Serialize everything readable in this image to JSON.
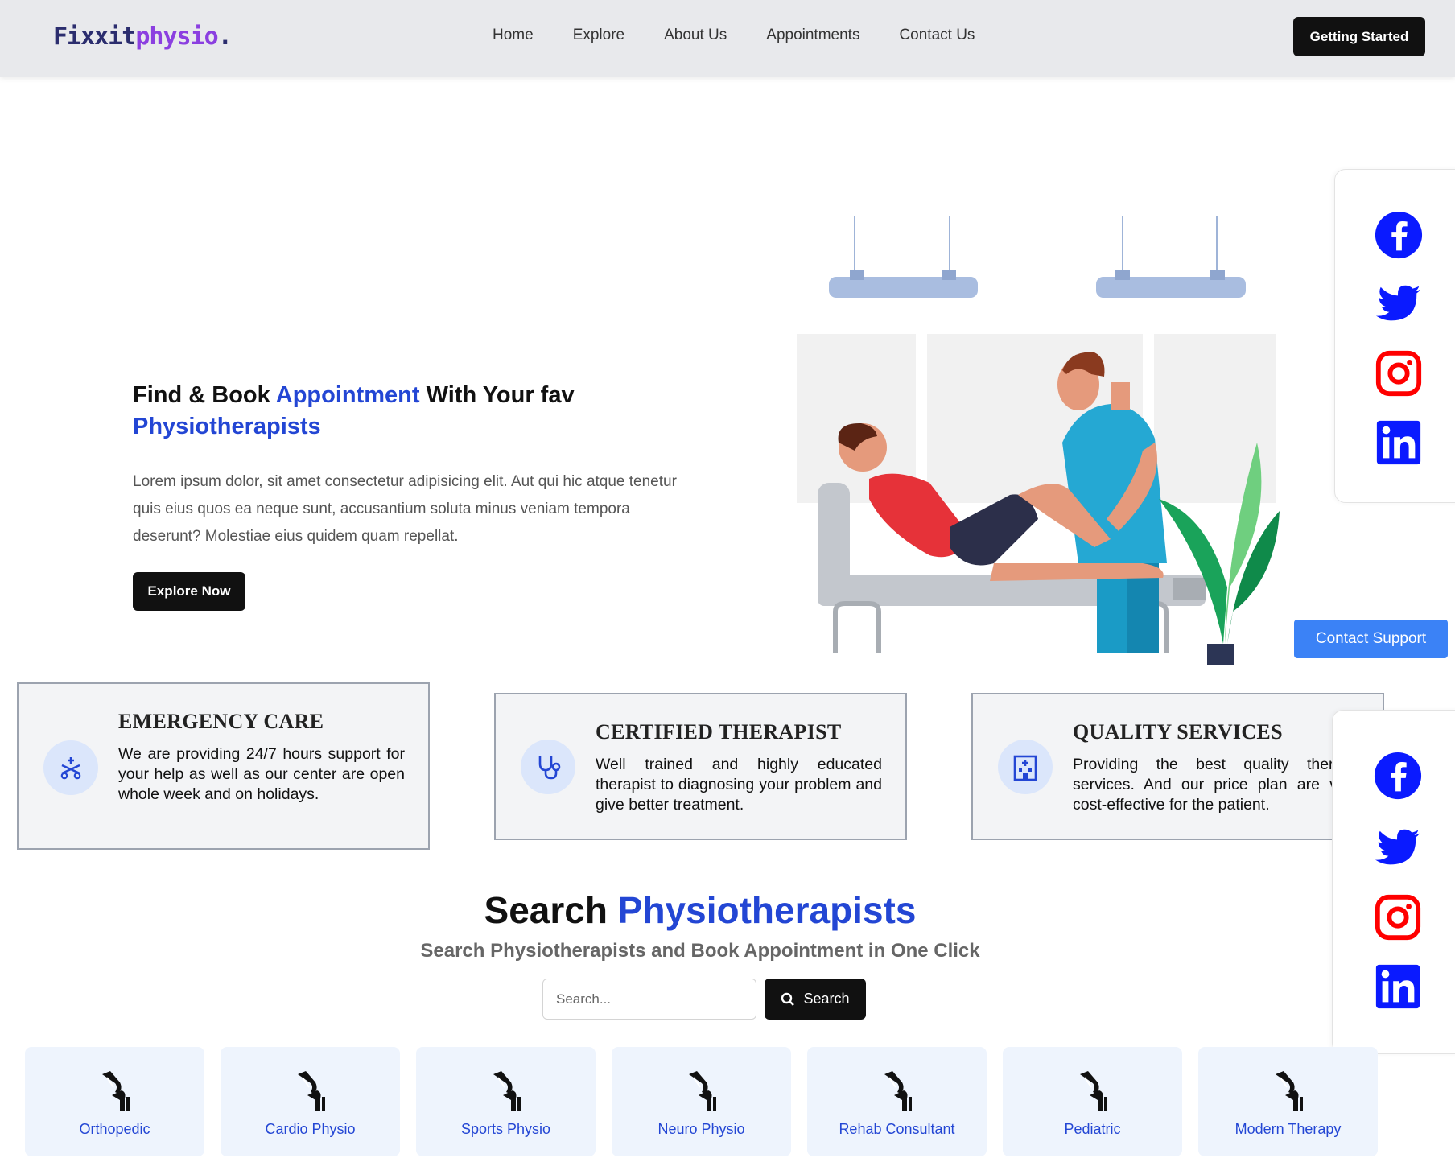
{
  "header": {
    "logo_part1": "Fixxit",
    "logo_part2": "physio",
    "logo_part3": ".",
    "nav": [
      "Home",
      "Explore",
      "About Us",
      "Appointments",
      "Contact Us"
    ],
    "cta_label": "Getting Started"
  },
  "hero": {
    "title_part1": "Find & Book ",
    "title_highlight1": "Appointment",
    "title_part2": " With Your fav ",
    "title_highlight2": "Physiotherapists",
    "description": "Lorem ipsum dolor, sit amet consectetur adipisicing elit. Aut qui hic atque tenetur quis eius quos ea neque sunt, accusantium soluta minus veniam tempora deserunt? Molestiae eius quidem quam repellat.",
    "button_label": "Explore Now"
  },
  "social": {
    "icons": [
      "facebook-icon",
      "twitter-icon",
      "instagram-icon",
      "linkedin-icon"
    ],
    "brand_color": "#0a1aff"
  },
  "support": {
    "label": "Contact Support"
  },
  "features": [
    {
      "icon": "ambulance-icon",
      "title": "EMERGENCY CARE",
      "text": "We are providing 24/7 hours support for your help as well as our center are open whole week and on holidays."
    },
    {
      "icon": "stethoscope-icon",
      "title": "CERTIFIED THERAPIST",
      "text": "Well trained and highly educated therapist to diagnosing your problem and give better treatment."
    },
    {
      "icon": "hospital-icon",
      "title": "QUALITY SERVICES",
      "text": "Providing the best quality therapy services. And our price plan are very cost-effective for the patient."
    }
  ],
  "search": {
    "title_part1": "Search ",
    "title_highlight": "Physiotherapists",
    "subtitle": "Search Physiotherapists and Book Appointment in One Click",
    "placeholder": "Search...",
    "button_label": "Search"
  },
  "categories": [
    "Orthopedic",
    "Cardio Physio",
    "Sports Physio",
    "Neuro Physio",
    "Rehab Consultant",
    "Pediatric",
    "Modern Therapy"
  ],
  "colors": {
    "accent": "#2346d4",
    "dark": "#111111",
    "support": "#3b82f6",
    "card_bg": "#f3f4f6",
    "category_bg": "#eef4fd"
  }
}
